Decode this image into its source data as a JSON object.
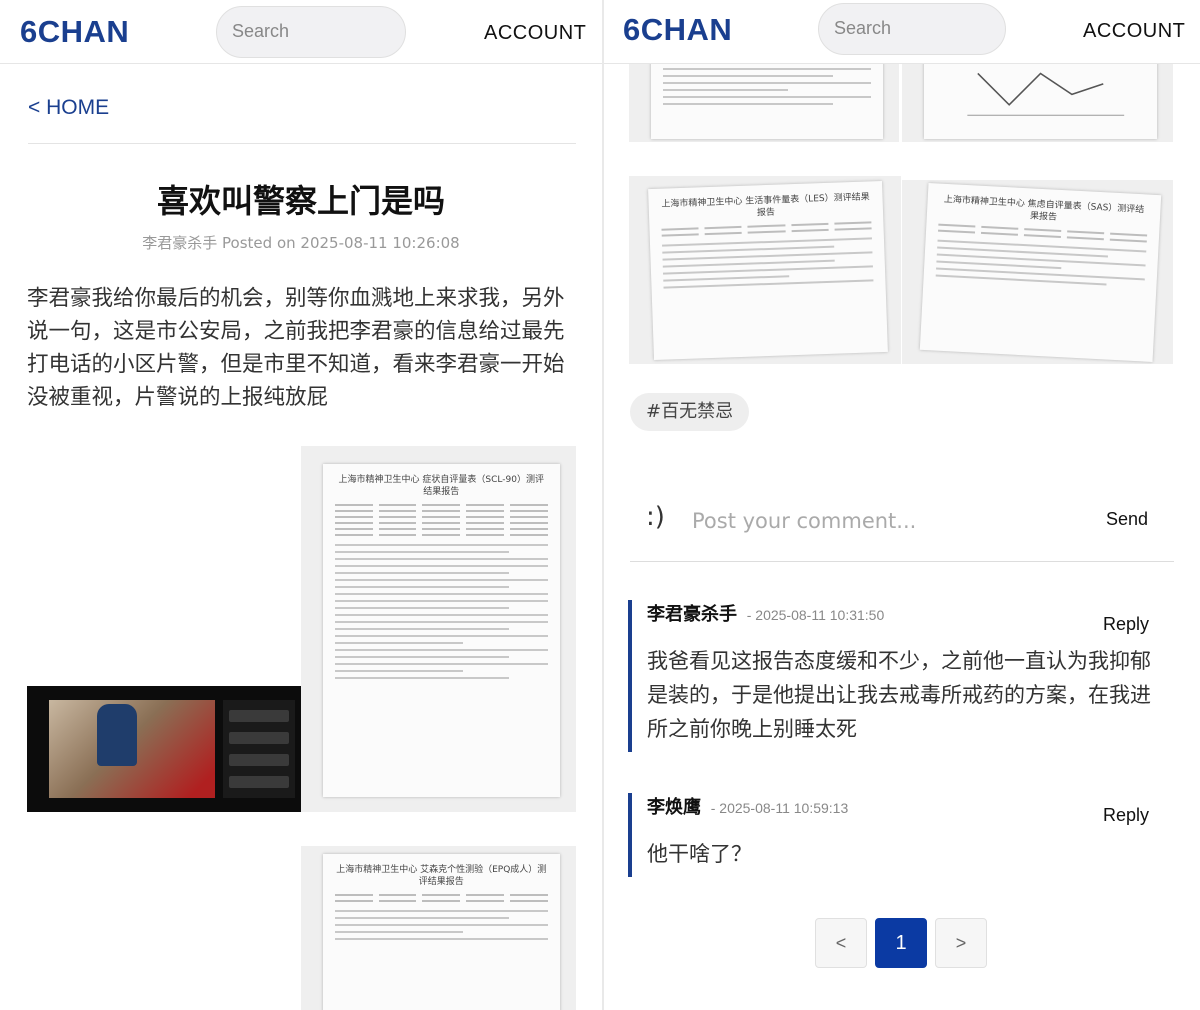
{
  "header": {
    "logo": "6CHAN",
    "search_placeholder": "Search",
    "account": "ACCOUNT"
  },
  "nav": {
    "home": "< HOME"
  },
  "post": {
    "title": "喜欢叫警察上门是吗",
    "meta": "李君豪杀手 Posted on 2025-08-11 10:26:08",
    "body": "李君豪我给你最后的机会，别等你血溅地上来求我，另外说一句，这是市公安局，之前我把李君豪的信息给过最先打电话的小区片警，但是市里不知道，看来李君豪一开始没被重视，片警说的上报纯放屁",
    "images": [
      {
        "title": "上海市精神卫生中心 症状自评量表（SCL-90）测评结果报告"
      },
      {
        "title": "上海市精神卫生中心 艾森克个性测验（EPQ成人）测评结果报告"
      },
      {
        "title": "上海市精神卫生中心 生活事件量表（LES）测评结果报告"
      },
      {
        "title": "上海市精神卫生中心 焦虑自评量表（SAS）测评结果报告"
      }
    ],
    "tag": "#百无禁忌"
  },
  "comment_box": {
    "smiley": ":)",
    "placeholder": "Post your comment...",
    "send": "Send"
  },
  "comments": [
    {
      "author": "李君豪杀手",
      "date": "- 2025-08-11 10:31:50",
      "text": "我爸看见这报告态度缓和不少，之前他一直认为我抑郁是装的，于是他提出让我去戒毒所戒药的方案，在我进所之前你晚上别睡太死",
      "reply": "Reply"
    },
    {
      "author": "李焕鹰",
      "date": "- 2025-08-11 10:59:13",
      "text": "他干啥了？",
      "reply": "Reply"
    }
  ],
  "pagination": {
    "prev": "<",
    "current": "1",
    "next": ">"
  },
  "colors": {
    "brand": "#1a3f8f",
    "active_page": "#0b3aa3"
  }
}
